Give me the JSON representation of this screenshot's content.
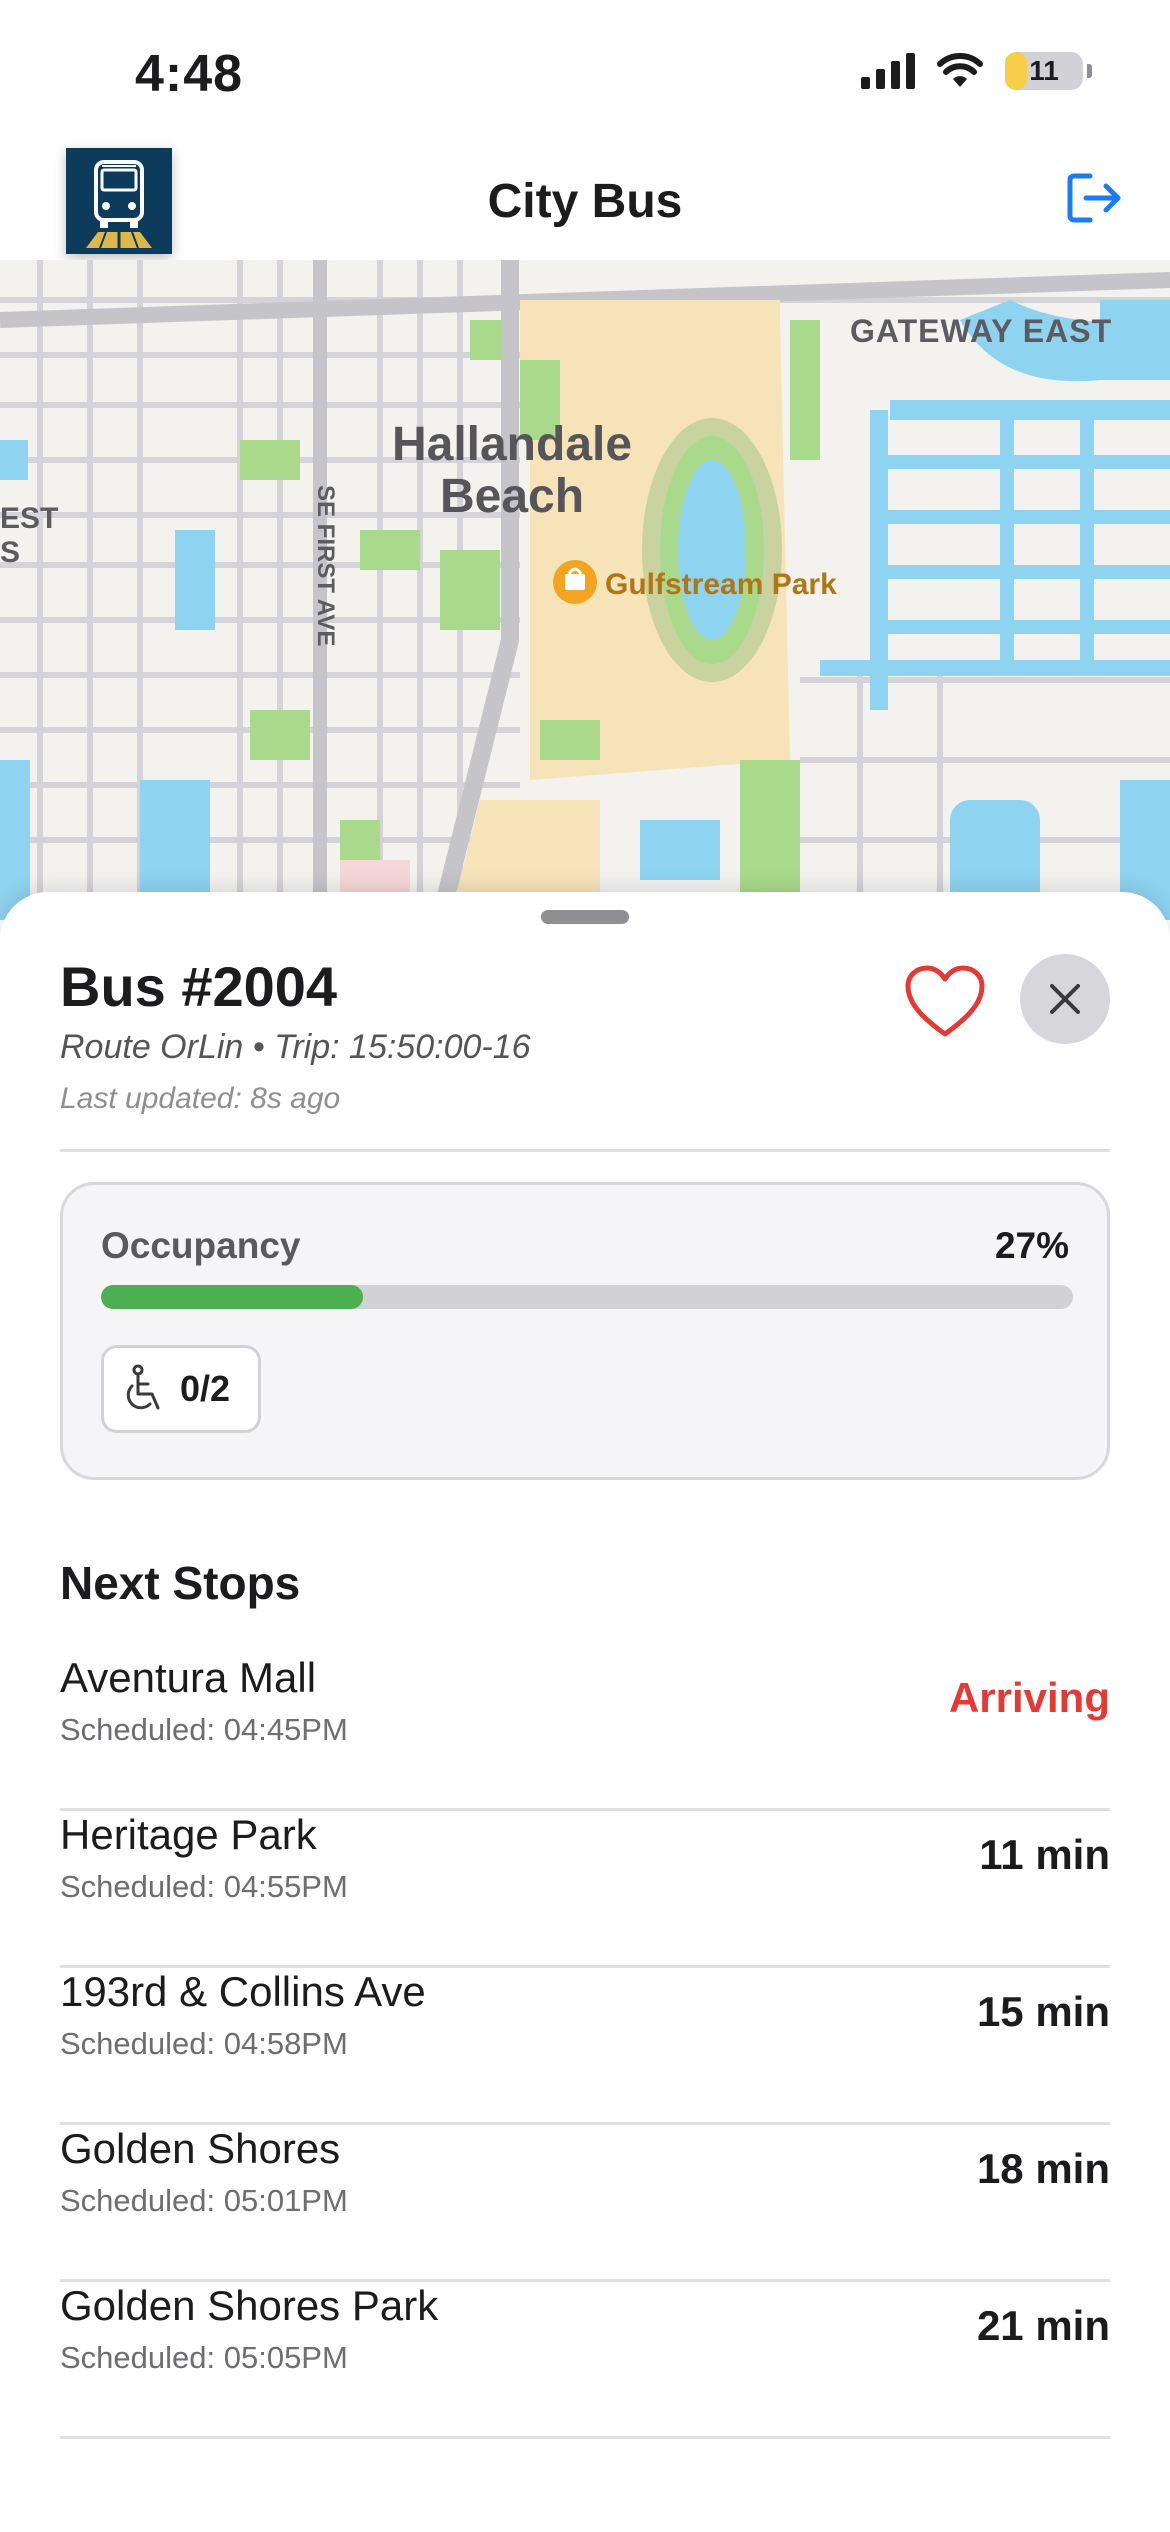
{
  "status_bar": {
    "time": "4:48",
    "battery_level": "11"
  },
  "nav": {
    "title": "City Bus",
    "logo_icon": "bus-icon",
    "logout_icon": "logout-icon"
  },
  "map": {
    "labels": {
      "neighborhood_line1": "Hallandale",
      "neighborhood_line2": "Beach",
      "gateway": "GATEWAY EAST",
      "street": "SE FIRST AVE",
      "poi": "Gulfstream Park",
      "west_partial": "EST",
      "west_partial2": "S"
    },
    "colors": {
      "land": "#f4f2ee",
      "park": "#a9d98a",
      "water": "#8ed3f0",
      "sand": "#f6e3b8",
      "road": "#c8c8cc"
    }
  },
  "bus": {
    "title": "Bus #2004",
    "route_line": "Route OrLin • Trip: 15:50:00-16",
    "last_updated": "Last updated: 8s ago",
    "favorite_icon": "heart-icon",
    "close_icon": "close-icon"
  },
  "occupancy": {
    "label": "Occupancy",
    "value_text": "27%",
    "fraction": 0.27,
    "fill_color": "#4caf50",
    "wheelchair": "0/2",
    "wheelchair_icon": "wheelchair-icon"
  },
  "next_stops": {
    "title": "Next Stops",
    "items": [
      {
        "name": "Aventura Mall",
        "scheduled": "Scheduled: 04:45PM",
        "eta": "Arriving",
        "arriving": true
      },
      {
        "name": "Heritage Park",
        "scheduled": "Scheduled: 04:55PM",
        "eta": "11 min",
        "arriving": false
      },
      {
        "name": "193rd & Collins Ave",
        "scheduled": "Scheduled: 04:58PM",
        "eta": "15 min",
        "arriving": false
      },
      {
        "name": "Golden Shores",
        "scheduled": "Scheduled: 05:01PM",
        "eta": "18 min",
        "arriving": false
      },
      {
        "name": "Golden Shores Park",
        "scheduled": "Scheduled: 05:05PM",
        "eta": "21 min",
        "arriving": false
      }
    ]
  }
}
